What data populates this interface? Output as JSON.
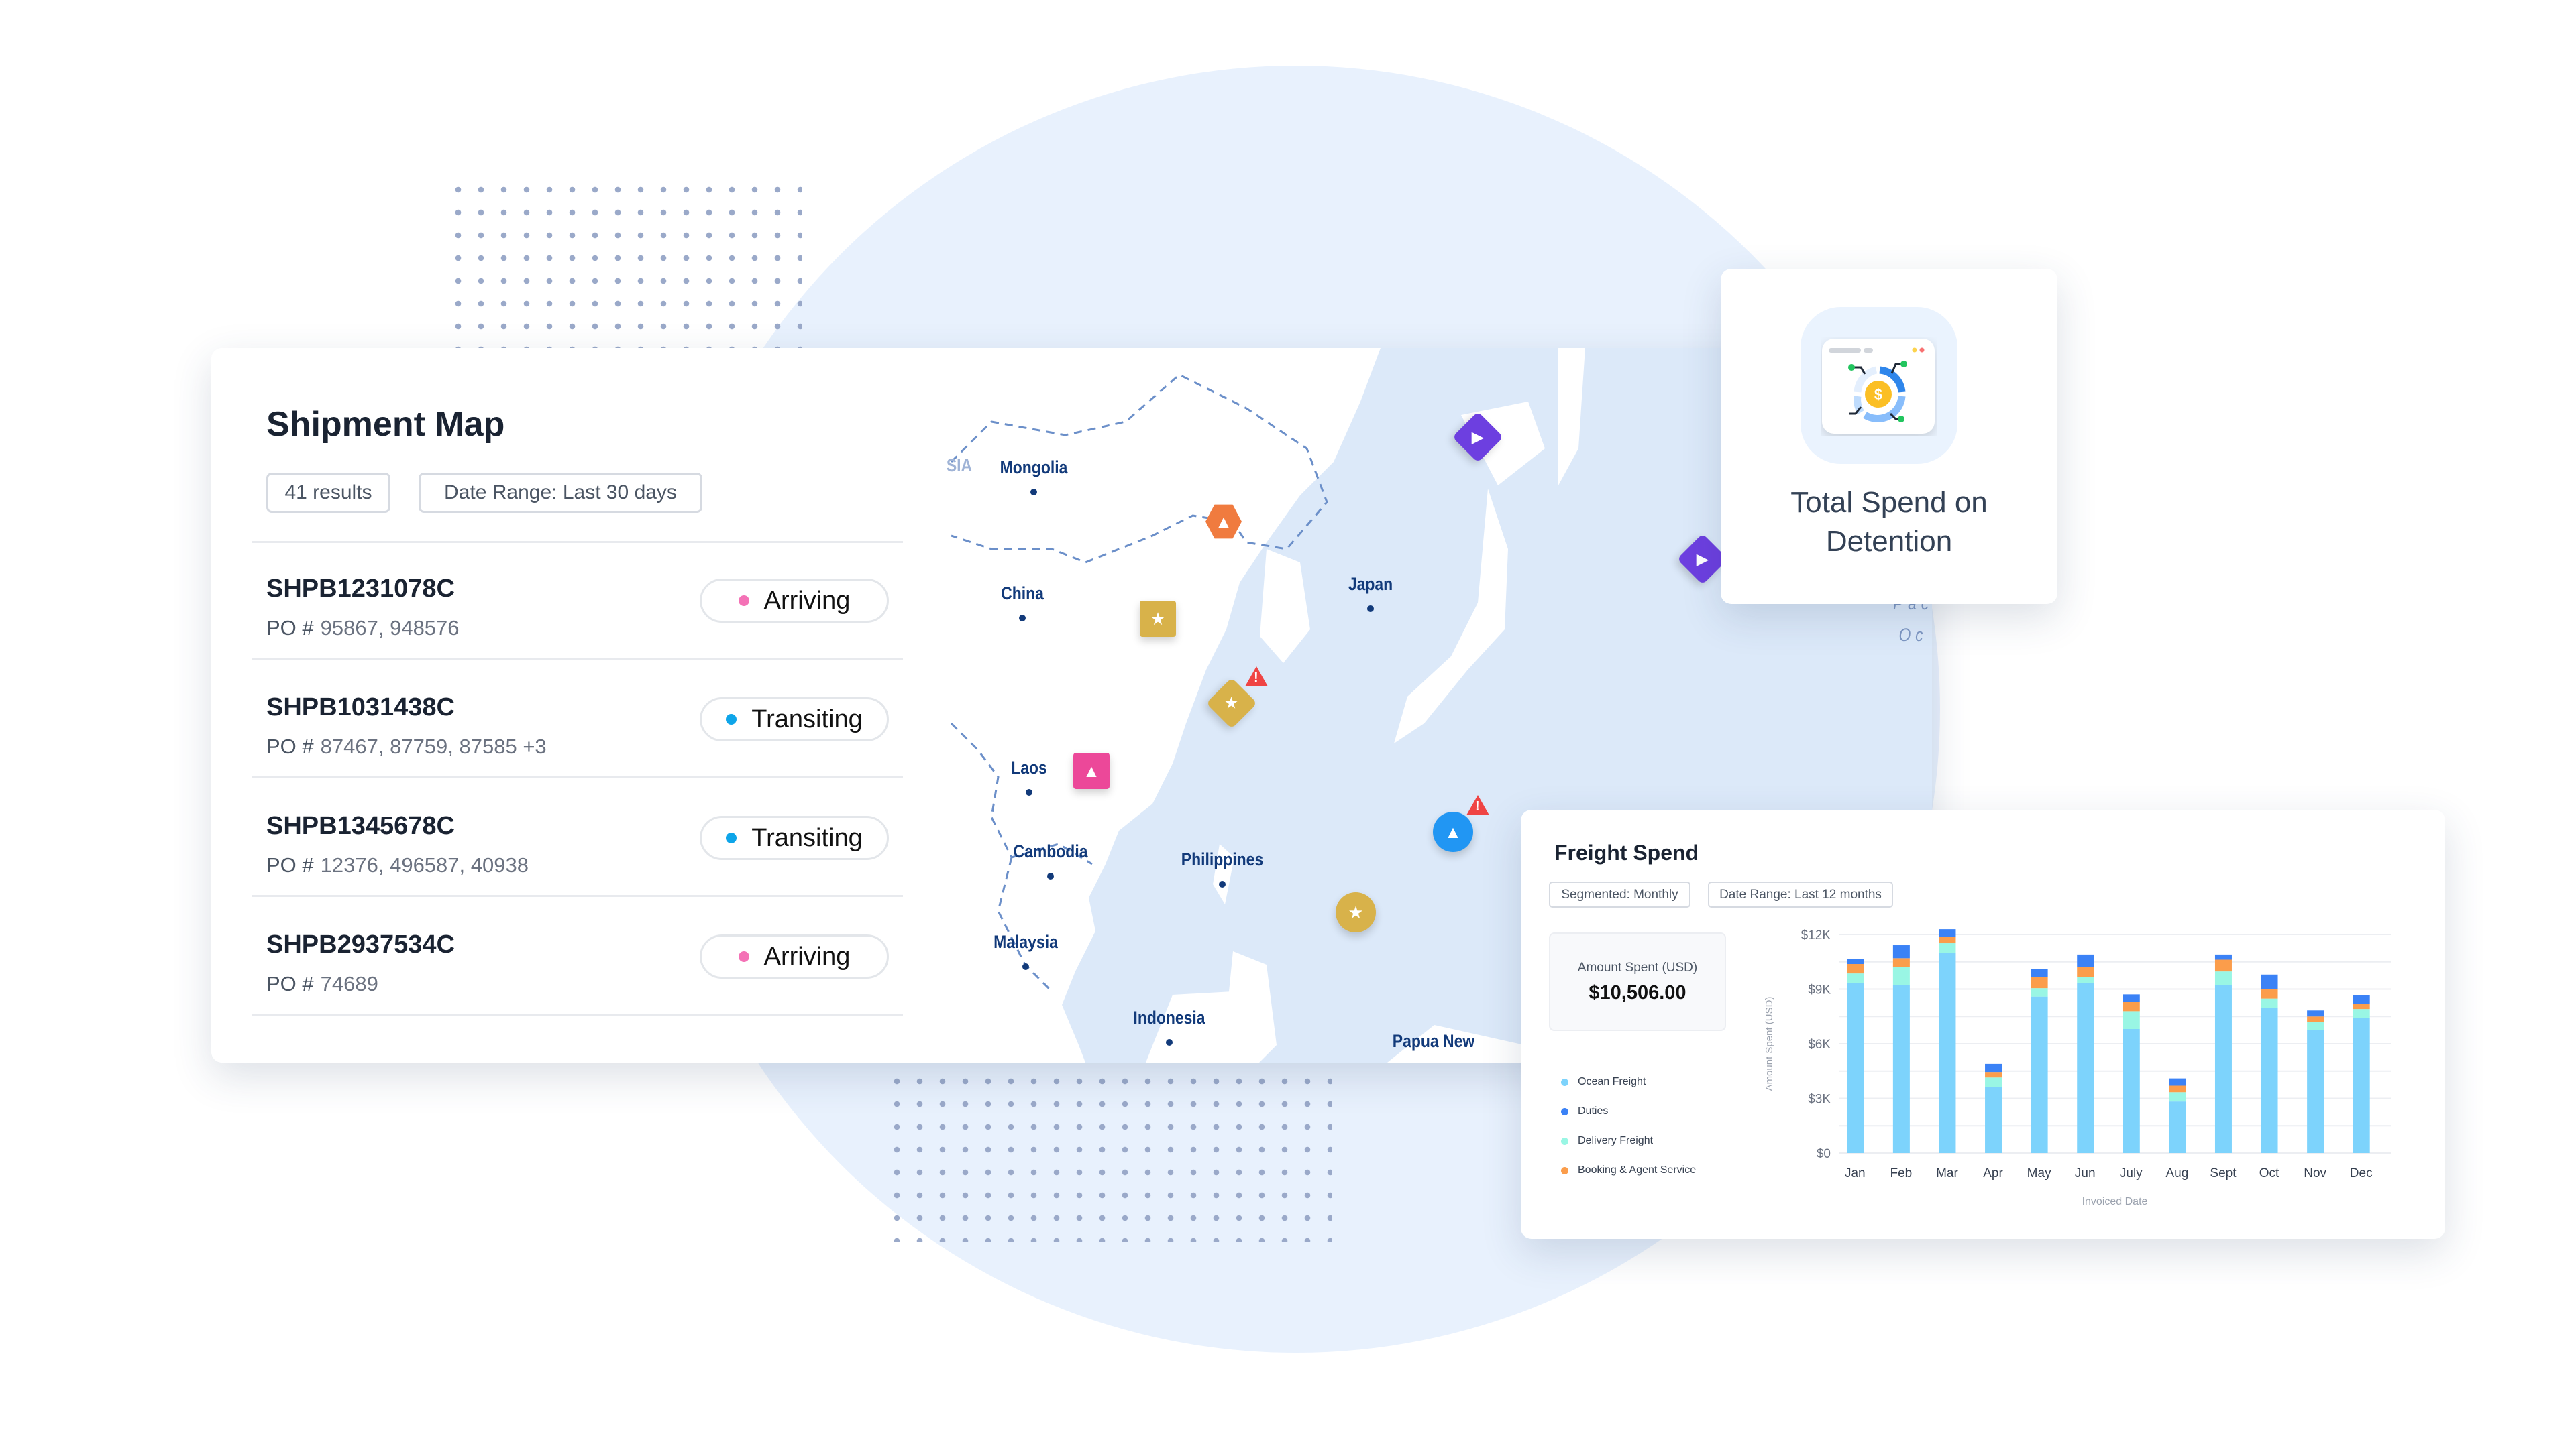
{
  "shipment_map": {
    "title": "Shipment Map",
    "results_chip": "41 results",
    "date_range_chip": "Date Range: Last 30 days",
    "shipments": [
      {
        "id": "SHPB1231078C",
        "po_label": "PO #",
        "po": "95867, 948576",
        "status": "Arriving",
        "status_color": "#f472b6"
      },
      {
        "id": "SHPB1031438C",
        "po_label": "PO #",
        "po": "87467, 87759, 87585 +3",
        "status": "Transiting",
        "status_color": "#0ea5e9"
      },
      {
        "id": "SHPB1345678C",
        "po_label": "PO #",
        "po": "12376, 496587, 40938",
        "status": "Transiting",
        "status_color": "#0ea5e9"
      },
      {
        "id": "SHPB2937534C",
        "po_label": "PO #",
        "po": "74689",
        "status": "Arriving",
        "status_color": "#f472b6"
      }
    ],
    "map": {
      "labels": [
        "SIA",
        "Mongolia",
        "China",
        "Japan",
        "Laos",
        "Cambodia",
        "Philippines",
        "Malaysia",
        "Indonesia",
        "Papua New",
        "Pac",
        "Oc"
      ],
      "markers": [
        {
          "type": "purple-diamond-play",
          "color": "#6d3fe0"
        },
        {
          "type": "purple-diamond-play",
          "color": "#6d3fe0"
        },
        {
          "type": "orange-hexagon-arrow",
          "color": "#f07b3f"
        },
        {
          "type": "gold-square-star",
          "color": "#d8b24a"
        },
        {
          "type": "gold-diamond-star",
          "color": "#d8b24a",
          "alert": true
        },
        {
          "type": "pink-square-arrow",
          "color": "#ec4899"
        },
        {
          "type": "blue-circle-arrow",
          "color": "#2196f3",
          "alert": true
        },
        {
          "type": "gold-circle-star",
          "color": "#d8b24a"
        }
      ]
    }
  },
  "detention": {
    "line1": "Total Spend on",
    "line2": "Detention",
    "icon": "spend-dashboard-icon"
  },
  "freight": {
    "title": "Freight Spend",
    "segment_chip": "Segmented: Monthly",
    "date_chip": "Date Range: Last 12 months",
    "amount_label": "Amount Spent (USD)",
    "amount_value": "$10,506.00"
  },
  "chart_data": {
    "type": "bar",
    "stacked": true,
    "xlabel": "Invoiced Date",
    "ylabel": "Amount Spent (USD)",
    "ylim": [
      0,
      12000
    ],
    "yticks": [
      "$0",
      "$3K",
      "$6K",
      "$9K",
      "$12K"
    ],
    "grid": true,
    "legend_placement": "left",
    "categories": [
      "Jan",
      "Feb",
      "Mar",
      "Apr",
      "May",
      "Jun",
      "July",
      "Aug",
      "Sept",
      "Oct",
      "Nov",
      "Dec"
    ],
    "series": [
      {
        "name": "Ocean Freight",
        "color": "#7dd3fc",
        "values": [
          9350,
          9220,
          11000,
          3640,
          8590,
          9350,
          6810,
          2830,
          9220,
          7970,
          6740,
          7430
        ]
      },
      {
        "name": "Delivery Freight",
        "color": "#99f6e4",
        "values": [
          510,
          980,
          520,
          510,
          460,
          330,
          980,
          510,
          750,
          510,
          460,
          480
        ]
      },
      {
        "name": "Booking & Agent Service",
        "color": "#fb9d4b",
        "values": [
          520,
          500,
          340,
          300,
          630,
          520,
          510,
          360,
          650,
          510,
          300,
          270
        ]
      },
      {
        "name": "Duties",
        "color": "#3b82f6",
        "values": [
          280,
          710,
          430,
          450,
          410,
          700,
          410,
          400,
          280,
          810,
          330,
          470
        ]
      }
    ],
    "legend_order": [
      "Ocean Freight",
      "Duties",
      "Delivery Freight",
      "Booking & Agent Service"
    ]
  }
}
